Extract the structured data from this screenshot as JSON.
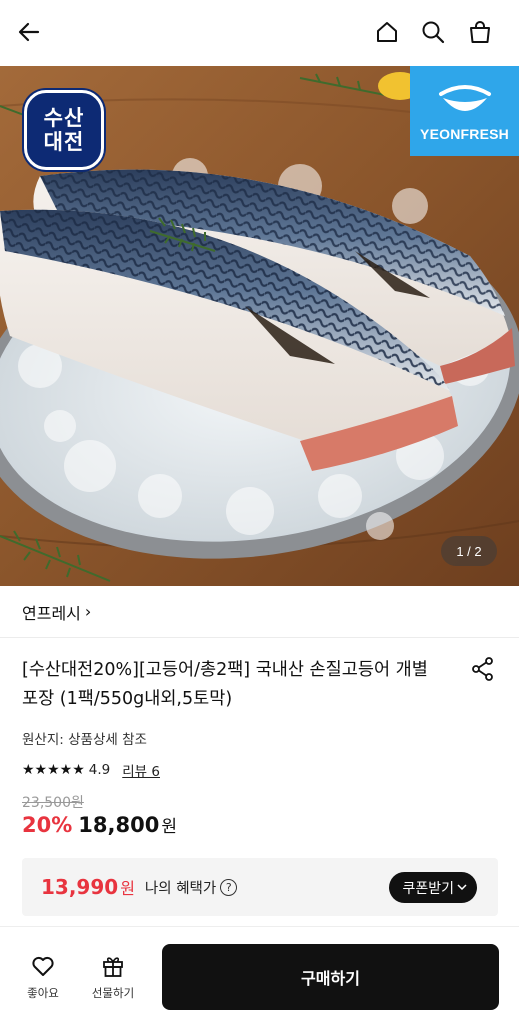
{
  "header": {
    "back_icon": "arrow-left-icon",
    "home_icon": "home-icon",
    "search_icon": "search-icon",
    "bag_icon": "shopping-bag-icon"
  },
  "gallery": {
    "badge_left_line1": "수산",
    "badge_left_line2": "대전",
    "badge_right_text": "YEONFRESH",
    "pager": "1 / 2",
    "current_page": 1,
    "total_pages": 2
  },
  "seller": {
    "name": "연프레시",
    "chevron": "›"
  },
  "product": {
    "title": "[수산대전20%][고등어/총2팩] 국내산 손질고등어 개별포장 (1팩/550g내외,5토막)",
    "origin": "원산지: 상품상세 참조",
    "stars": "★★★★★",
    "rating": "4.9",
    "review_label": "리뷰 6",
    "original_price": "23,500원",
    "discount": "20%",
    "price": "18,800",
    "price_unit": "원"
  },
  "benefit": {
    "price": "13,990",
    "unit": "원",
    "label": "나의 혜택가",
    "help": "?",
    "coupon_button": "쿠폰받기"
  },
  "bottom": {
    "like_label": "좋아요",
    "gift_label": "선물하기",
    "buy_label": "구매하기"
  },
  "colors": {
    "accent_red": "#e8343f",
    "dark": "#111111",
    "badge_navy": "#0d2a74",
    "badge_blue": "#2fa6ea"
  }
}
